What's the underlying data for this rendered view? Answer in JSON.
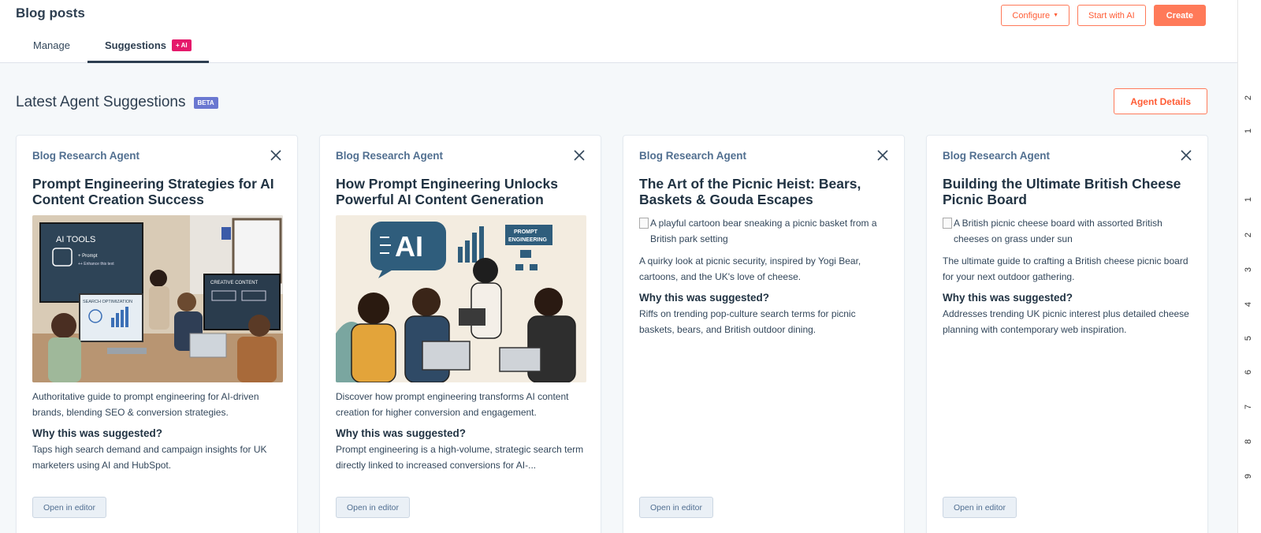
{
  "header": {
    "title": "Blog posts",
    "configure_label": "Configure",
    "start_ai_label": "Start with AI",
    "create_label": "Create"
  },
  "tabs": [
    {
      "label": "Manage",
      "active": false
    },
    {
      "label": "Suggestions",
      "active": true,
      "badge": "+ AI"
    }
  ],
  "section": {
    "title": "Latest Agent Suggestions",
    "badge": "BETA",
    "agent_details_label": "Agent Details"
  },
  "cards": [
    {
      "agent": "Blog Research Agent",
      "title": "Prompt Engineering Strategies for AI Content Creation Success",
      "image_type": "photo",
      "image_texts": [
        "AI TOOLS",
        "+ Prompt",
        "++ Enhance this text",
        "SEARCH OPTIMIZATION",
        "CREATIVE CONTENT"
      ],
      "description": "Authoritative guide to prompt engineering for AI-driven brands, blending SEO & conversion strategies.",
      "why_title": "Why this was suggested?",
      "why_text": "Taps high search demand and campaign insights for UK marketers using AI and HubSpot.",
      "button": "Open in editor"
    },
    {
      "agent": "Blog Research Agent",
      "title": "How Prompt Engineering Unlocks Powerful AI Content Generation",
      "image_type": "illustration",
      "image_texts": [
        "AI",
        "PROMPT",
        "ENGINEERING"
      ],
      "description": "Discover how prompt engineering transforms AI content creation for higher conversion and engagement.",
      "why_title": "Why this was suggested?",
      "why_text": "Prompt engineering is a high-volume, strategic search term directly linked to increased conversions for AI-...",
      "button": "Open in editor"
    },
    {
      "agent": "Blog Research Agent",
      "title": "The Art of the Picnic Heist: Bears, Baskets & Gouda Escapes",
      "image_type": "broken",
      "image_alt": "A playful cartoon bear sneaking a picnic basket from a British park setting",
      "description": "A quirky look at picnic security, inspired by Yogi Bear, cartoons, and the UK's love of cheese.",
      "why_title": "Why this was suggested?",
      "why_text": "Riffs on trending pop-culture search terms for picnic baskets, bears, and British outdoor dining.",
      "button": "Open in editor"
    },
    {
      "agent": "Blog Research Agent",
      "title": "Building the Ultimate British Cheese Picnic Board",
      "image_type": "broken",
      "image_alt": "A British picnic cheese board with assorted British cheeses on grass under sun",
      "description": "The ultimate guide to crafting a British cheese picnic board for your next outdoor gathering.",
      "why_title": "Why this was suggested?",
      "why_text": "Addresses trending UK picnic interest plus detailed cheese planning with contemporary web inspiration.",
      "button": "Open in editor"
    }
  ],
  "ruler": [
    "2",
    "1",
    "1",
    "2",
    "3",
    "4",
    "5",
    "6",
    "7",
    "8",
    "9"
  ],
  "colors": {
    "accent": "#ff7a59",
    "ai_badge": "#e5196b",
    "beta_badge": "#6a78d1",
    "text_dark": "#213343"
  }
}
